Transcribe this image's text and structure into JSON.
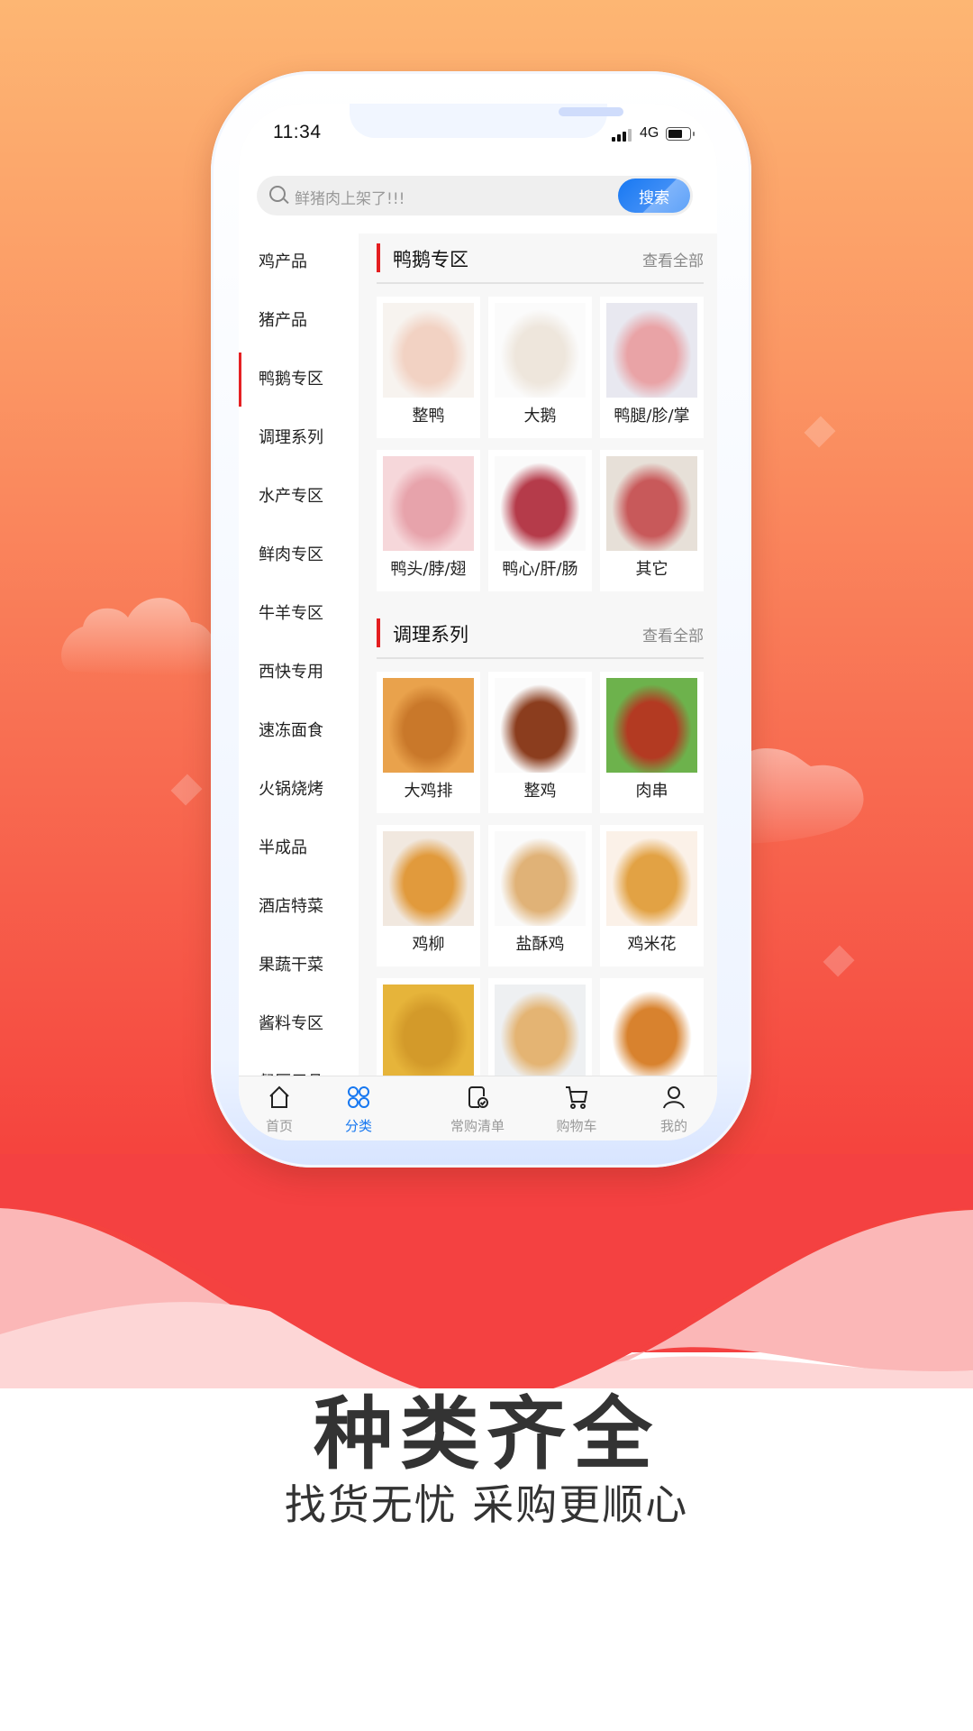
{
  "status_bar": {
    "time": "11:34",
    "network": "4G"
  },
  "search": {
    "placeholder": "鲜猪肉上架了!!!",
    "button_label": "搜索"
  },
  "sidebar": {
    "active_index": 2,
    "items": [
      "鸡产品",
      "猪产品",
      "鸭鹅专区",
      "调理系列",
      "水产专区",
      "鲜肉专区",
      "牛羊专区",
      "西快专用",
      "速冻面食",
      "火锅烧烤",
      "半成品",
      "酒店特菜",
      "果蔬干菜",
      "酱料专区",
      "餐厨用品"
    ]
  },
  "sections": [
    {
      "title": "鸭鹅专区",
      "more_label": "查看全部",
      "products": [
        {
          "name": "整鸭",
          "image": "whole-duck"
        },
        {
          "name": "大鹅",
          "image": "goose"
        },
        {
          "name": "鸭腿/胗/掌",
          "image": "duck-leg"
        },
        {
          "name": "鸭头/脖/翅",
          "image": "duck-wing"
        },
        {
          "name": "鸭心/肝/肠",
          "image": "duck-heart"
        },
        {
          "name": "其它",
          "image": "duck-blood"
        }
      ]
    },
    {
      "title": "调理系列",
      "more_label": "查看全部",
      "products": [
        {
          "name": "大鸡排",
          "image": "chicken-steak"
        },
        {
          "name": "整鸡",
          "image": "roast-chicken"
        },
        {
          "name": "肉串",
          "image": "meat-skewers"
        },
        {
          "name": "鸡柳",
          "image": "chicken-strips"
        },
        {
          "name": "盐酥鸡",
          "image": "salt-chicken"
        },
        {
          "name": "鸡米花",
          "image": "popcorn-chicken"
        },
        {
          "name": "",
          "image": "nuggets"
        },
        {
          "name": "",
          "image": "fried-shrimp"
        },
        {
          "name": "",
          "image": "burger"
        }
      ]
    }
  ],
  "tabbar": {
    "active_index": 1,
    "items": [
      {
        "label": "首页",
        "icon": "home-icon"
      },
      {
        "label": "分类",
        "icon": "category-icon"
      },
      {
        "label": "常购清单",
        "icon": "list-check-icon"
      },
      {
        "label": "购物车",
        "icon": "cart-icon"
      },
      {
        "label": "我的",
        "icon": "user-icon"
      }
    ]
  },
  "promo": {
    "headline": "种类齐全",
    "subline": "找货无忧 采购更顺心"
  },
  "colors": {
    "accent_red": "#e41e20",
    "accent_blue": "#1677f0",
    "bg_top": "#fdb673",
    "bg_bottom": "#f44141"
  }
}
